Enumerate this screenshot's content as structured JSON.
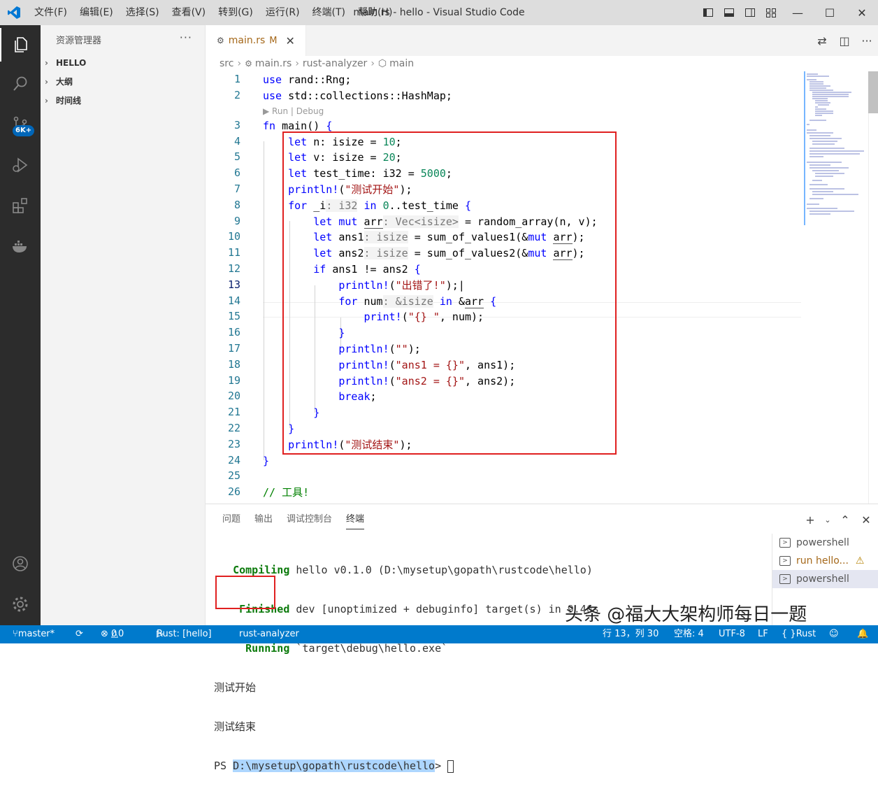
{
  "titlebar": {
    "menu": [
      "文件(F)",
      "编辑(E)",
      "选择(S)",
      "查看(V)",
      "转到(G)",
      "运行(R)",
      "终端(T)",
      "帮助(H)"
    ],
    "title": "main.rs - hello - Visual Studio Code"
  },
  "activity": {
    "badge": "6K+"
  },
  "sidebar": {
    "title": "资源管理器",
    "more": "···",
    "sections": [
      "HELLO",
      "大纲",
      "时间线"
    ]
  },
  "tab": {
    "name": "main.rs",
    "modified": "M"
  },
  "breadcrumb": [
    "src",
    "main.rs",
    "rust-analyzer",
    "main"
  ],
  "code": {
    "codelens": "▶ Run | Debug",
    "current_line": 13
  },
  "panel": {
    "tabs": [
      "问题",
      "输出",
      "调试控制台",
      "终端"
    ],
    "active_tab": "终端",
    "terminal_list": [
      "powershell",
      "run hello...",
      "powershell"
    ],
    "terminal": {
      "l1_kw": "Compiling",
      "l1_text": " hello v0.1.0 (D:\\mysetup\\gopath\\rustcode\\hello)",
      "l2_kw": "Finished",
      "l2_text": " dev [unoptimized + debuginfo] target(s) in 9.46s",
      "l3_kw": "Running",
      "l3_text": " `target\\debug\\hello.exe`",
      "l4": "测试开始",
      "l5": "测试结束",
      "prompt_ps": "PS ",
      "prompt_path": "D:\\mysetup\\gopath\\rustcode\\hello",
      "prompt_gt": "> "
    }
  },
  "watermark": "头条 @福大大架构师每日一题",
  "statusbar": {
    "branch": "master*",
    "errors": "0",
    "warnings": "0",
    "run": "Rust: [hello]",
    "analyzer": "rust-analyzer",
    "position": "行 13，列 30",
    "spaces": "空格: 4",
    "encoding": "UTF-8",
    "eol": "LF",
    "language": "Rust"
  }
}
